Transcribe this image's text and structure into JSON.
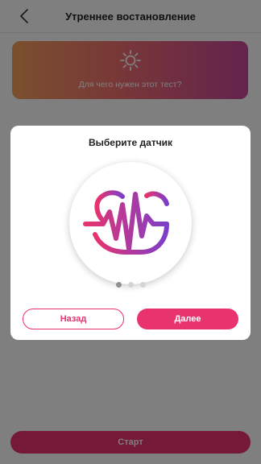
{
  "header": {
    "title": "Утреннее востановление",
    "back_icon": "chevron-left-icon"
  },
  "info_card": {
    "icon": "sun-icon",
    "text": "Для чего нужен этот тест?"
  },
  "start_button": {
    "label": "Старт"
  },
  "modal": {
    "title": "Выберите датчик",
    "logo_icon": "pulse-s-logo-icon",
    "pagination": {
      "total": 3,
      "active": 1
    },
    "back_label": "Назад",
    "next_label": "Далее"
  },
  "colors": {
    "accent": "#e8336e",
    "card_gradient": [
      "#f5a05c",
      "#f07070",
      "#c8479b"
    ],
    "logo_gradient": [
      "#e8336e",
      "#7c3fc8"
    ],
    "overlay": "rgba(0,0,0,0.5)"
  }
}
